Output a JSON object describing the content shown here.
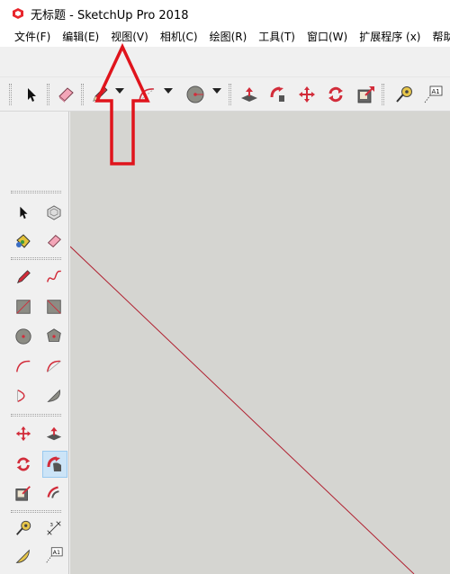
{
  "window": {
    "title": "无标题 - SketchUp Pro 2018",
    "app_icon": "sketchup-icon"
  },
  "menu": {
    "items": [
      {
        "label": "文件(F)"
      },
      {
        "label": "编辑(E)"
      },
      {
        "label": "视图(V)"
      },
      {
        "label": "相机(C)"
      },
      {
        "label": "绘图(R)"
      },
      {
        "label": "工具(T)"
      },
      {
        "label": "窗口(W)"
      },
      {
        "label": "扩展程序 (x)"
      },
      {
        "label": "帮助("
      }
    ]
  },
  "toolbar": {
    "tools": [
      "select-icon",
      "eraser-icon",
      "pencil-icon",
      "arc-icon",
      "circle-icon",
      "push-pull-icon",
      "follow-me-icon",
      "move-icon",
      "rotate-icon",
      "scale-icon",
      "tape-measure-icon",
      "text-icon"
    ],
    "text_tool_label": "A1"
  },
  "left_toolbar": {
    "text_tool_label": "A1",
    "selected_tool": "follow-me"
  },
  "annotation": {
    "arrow_color": "#e0141c",
    "points_to": "视图(V)"
  },
  "colors": {
    "canvas": "#d5d5d1",
    "axis_line": "#b02030"
  }
}
